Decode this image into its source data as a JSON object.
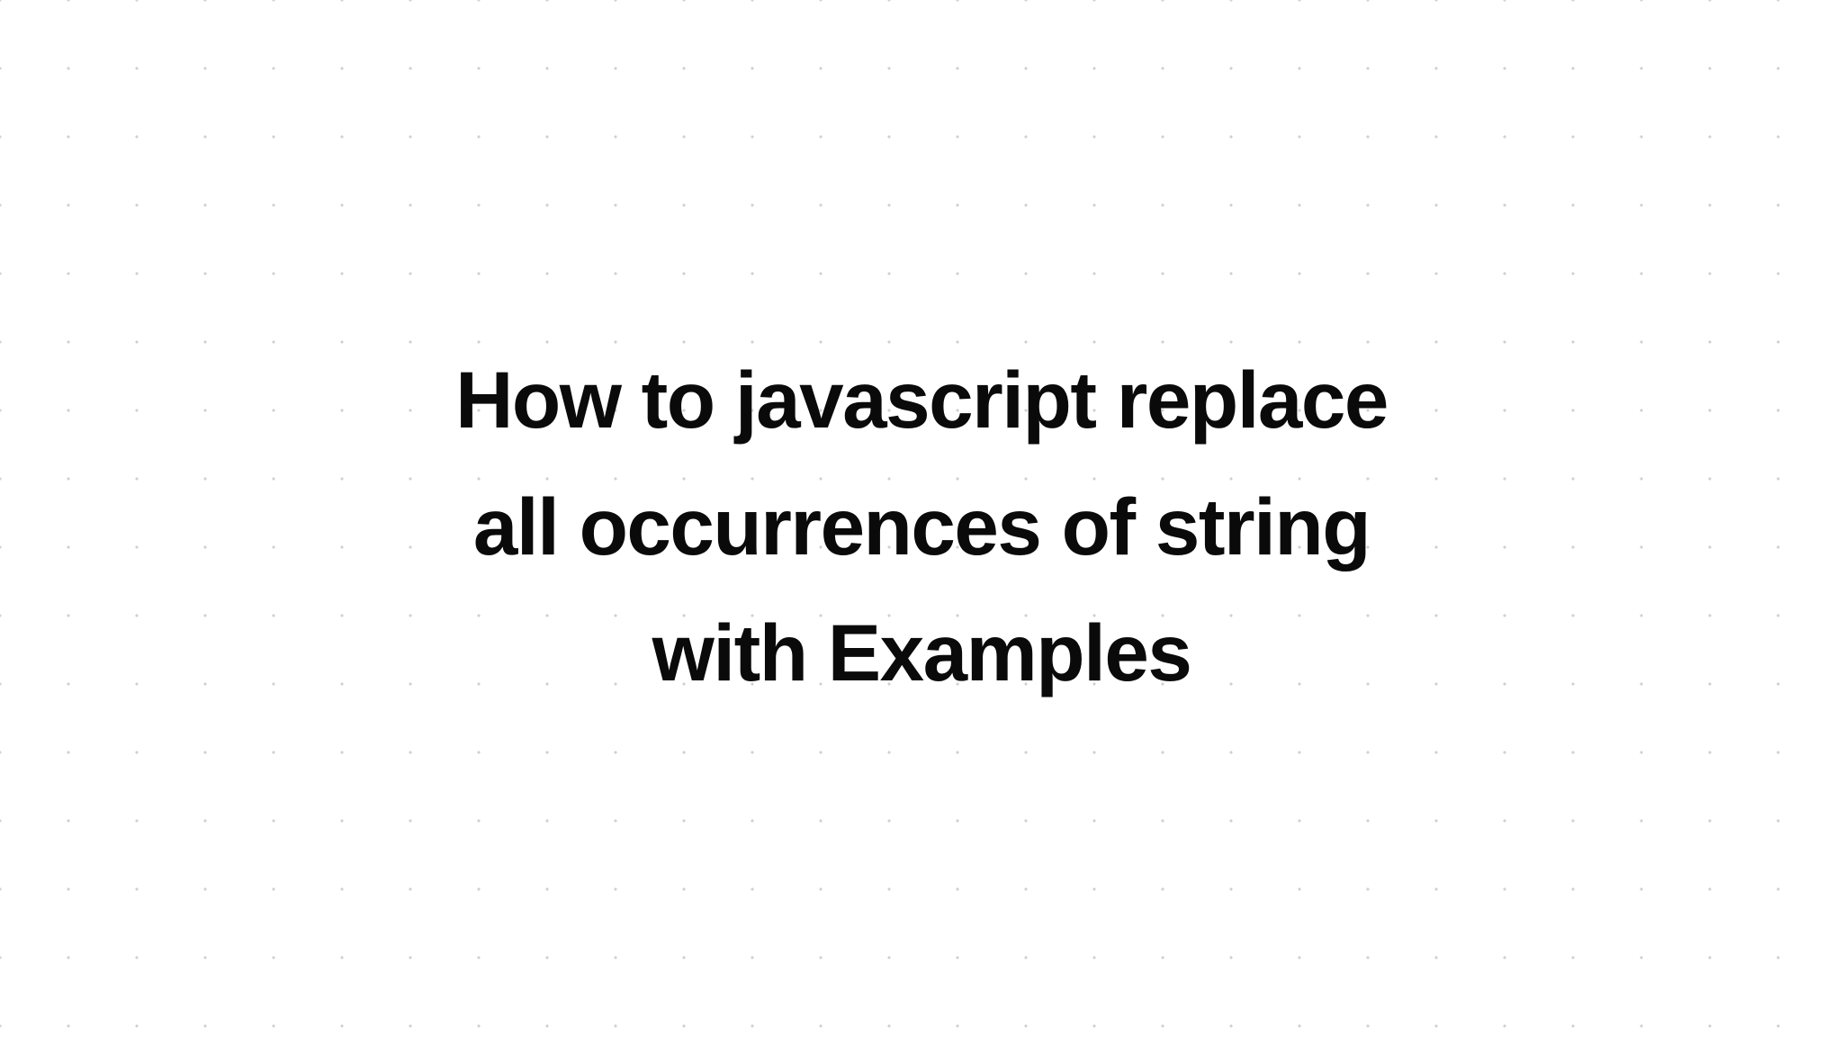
{
  "title": "How to javascript replace all occurrences of string with Examples"
}
